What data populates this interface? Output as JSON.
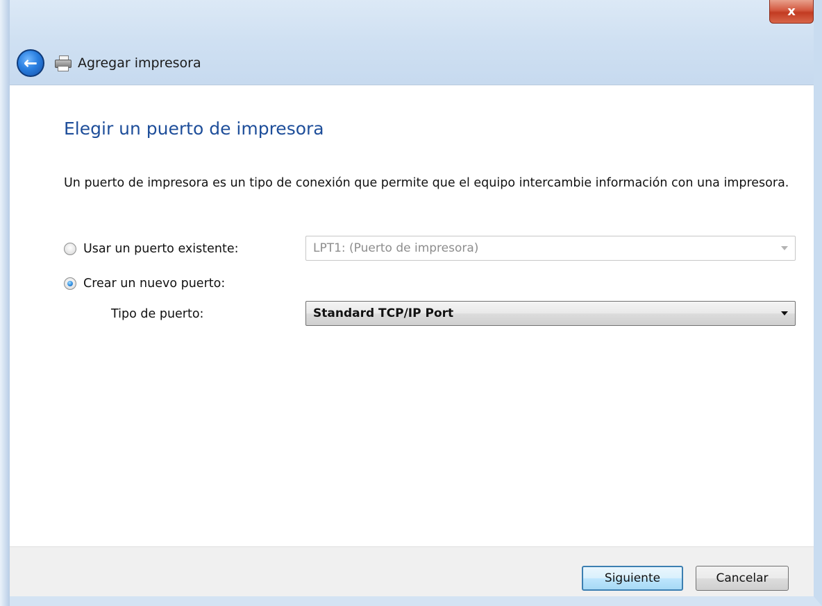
{
  "window": {
    "title": "Agregar impresora",
    "close_glyph": "x"
  },
  "nav": {
    "back_glyph": "←",
    "printer_icon": "printer-icon"
  },
  "heading": "Elegir un puerto de impresora",
  "description": "Un puerto de impresora es un tipo de conexión que permite que el equipo intercambie información con una impresora.",
  "options": {
    "existing": {
      "label": "Usar un puerto existente:",
      "selected": false,
      "value": "LPT1: (Puerto de impresora)"
    },
    "new": {
      "label": "Crear un nuevo puerto:",
      "selected": true,
      "type_label": "Tipo de puerto:",
      "type_value": "Standard TCP/IP Port"
    }
  },
  "footer": {
    "next_label": "Siguiente",
    "cancel_label": "Cancelar"
  }
}
